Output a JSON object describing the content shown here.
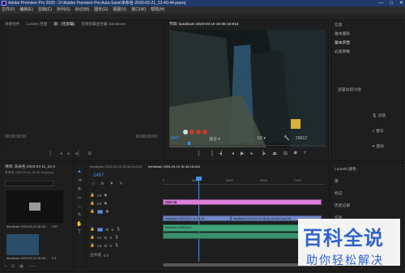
{
  "app": {
    "title": "Adobe Premiere Pro 2020 - D:\\Adobe Premiere Pro Auto-Save\\未命名-2020-03-21_22-40-44.prproj",
    "window_controls": [
      "—",
      "□",
      "✕"
    ]
  },
  "menu": [
    "文件(F)",
    "编辑(E)",
    "剪辑(C)",
    "序列(S)",
    "标记(M)",
    "图形(G)",
    "视图(V)",
    "窗口(W)",
    "帮助(H)"
  ],
  "source_panel": {
    "tabs": [
      "效果控件",
      "Lumetri 范围",
      "源：(无剪辑)",
      "音频剪辑混合器: bandicam"
    ],
    "active_tab": 2,
    "timecode_left": "00;00;00;00",
    "timecode_right": "00;00;00;00"
  },
  "program_panel": {
    "title": "节目: bandicam 2020-03-19 18-36-16-815",
    "timecode": "2467",
    "fit": "适合",
    "resolution": "1/2",
    "duration": "20612",
    "colors": {
      "accent": "#4a90e2",
      "playhead": "#4a90e2"
    }
  },
  "right_panel": {
    "items": [
      "信息",
      "基本图形",
      "基本声音",
      "必选参数"
    ],
    "sub_title": "还是比较对话",
    "rows": [
      "▾",
      "",
      "对话"
    ],
    "music_label": "音乐",
    "sfx_label": "音效"
  },
  "right_lower": {
    "items": [
      "Lumetri 颜色",
      "库",
      "标记",
      "历史记录",
      "信息"
    ]
  },
  "project_panel": {
    "title": "项目: 未命名-2020-03-11_22-4",
    "subtitle": "未命名-2020-03-11_22-40-44.prproj",
    "tabs": [
      "项目",
      "媒体浏览器"
    ],
    "folder_label": "",
    "item_label": "bandicam 2020-03-19 18-36-16",
    "item_duration": "2:57",
    "item2_label": "bandicam 2020-03-19 18-36-16-815",
    "item2_duration": "2:3"
  },
  "timeline": {
    "tabs": [
      "bandicam 2020-03-19 18-36-16-815",
      "bandicam 2020-03-19 18-36-16-815"
    ],
    "active_tab": 1,
    "timecode": "2467",
    "ruler": [
      "0",
      "1800",
      "3600",
      "5400",
      "7200"
    ],
    "video_tracks": [
      "V3",
      "V2",
      "V1"
    ],
    "audio_tracks": [
      "A1",
      "A2",
      "A3"
    ],
    "master_label": "主声道",
    "master_value": "0.0",
    "clips": {
      "title_clip": "视频字幕",
      "v1_clip_a": "bandicam 2020-03-1 11-39-14",
      "v1_clip_b": "bandicam 2020-03-19 18-36-16-815.mp4 [V]",
      "a1_clip": "bandicam 2020-03-1"
    },
    "colors": {
      "title_clip": "#d97fd9",
      "video_clip": "#6f87c7",
      "audio_clip": "#3fa37a"
    }
  },
  "watermark": {
    "brand_text": "百科全说",
    "slogan": "助你轻松解决",
    "colors": {
      "brand": "#2f63c9",
      "slogan": "#2f63c9"
    }
  }
}
